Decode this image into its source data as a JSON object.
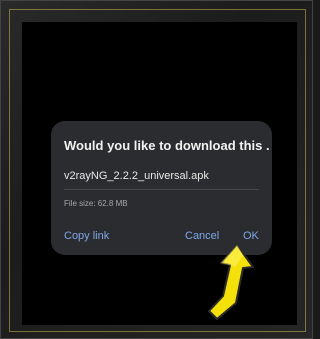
{
  "dialog": {
    "title": "Would you like to download this ...",
    "file_name": "v2rayNG_2.2.2_universal.apk",
    "file_size": "File size: 62.8 MB",
    "copy_link_label": "Copy link",
    "cancel_label": "Cancel",
    "ok_label": "OK"
  },
  "annotation": {
    "arrow_icon": "yellow-pointer-arrow-icon",
    "arrow_color": "#f5e10a"
  },
  "colors": {
    "dialog_bg": "#2b2c2f",
    "button_text": "#7fa7ea",
    "frame_border": "#c9b84a"
  }
}
